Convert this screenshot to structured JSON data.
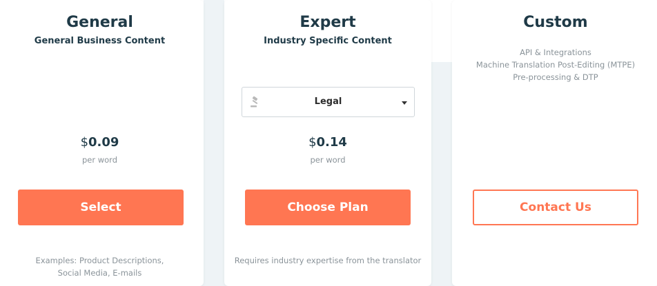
{
  "plans": [
    {
      "title": "General",
      "subtitle": "General Business Content",
      "price_symbol": "$",
      "price_amount": "0.09",
      "price_unit": "per word",
      "button_label": "Select",
      "note_lines": [
        "Examples: Product Descriptions,",
        "Social Media, E-mails"
      ]
    },
    {
      "title": "Expert",
      "subtitle": "Industry Specific Content",
      "dropdown_selected": "Legal",
      "dropdown_icon": "gavel-icon",
      "price_symbol": "$",
      "price_amount": "0.14",
      "price_unit": "per word",
      "button_label": "Choose Plan",
      "note_lines": [
        "Requires industry expertise from the translator"
      ]
    },
    {
      "title": "Custom",
      "features": [
        "API & Integrations",
        "Machine Translation Post-Editing (MTPE)",
        "Pre-processing & DTP"
      ],
      "button_label": "Contact Us"
    }
  ],
  "colors": {
    "accent": "#ff7652",
    "heading": "#1f3a47",
    "muted": "#8a9399",
    "background": "#eef3f6"
  }
}
